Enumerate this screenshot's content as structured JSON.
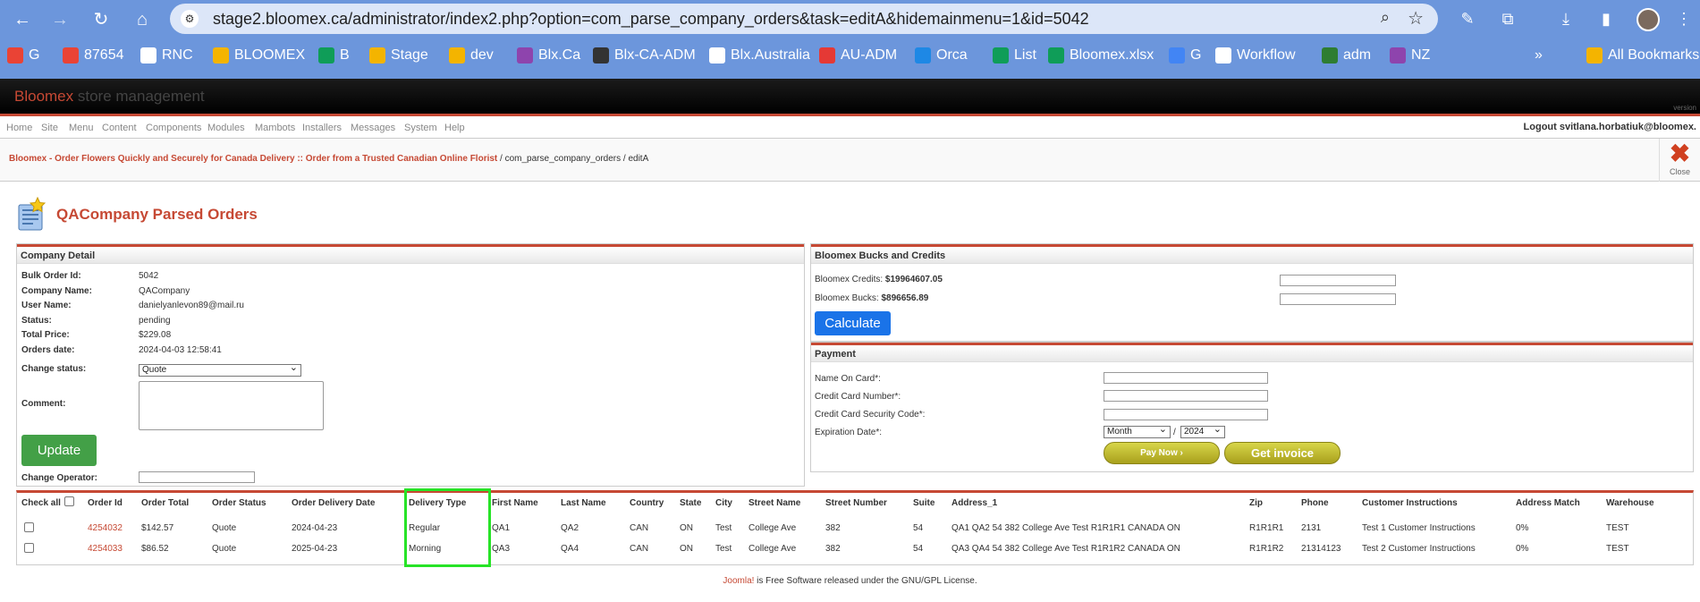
{
  "browser": {
    "url": "stage2.bloomex.ca/administrator/index2.php?option=com_parse_company_orders&task=editA&hidemainmenu=1&id=5042",
    "bookmarks": [
      {
        "label": "G",
        "color": "#ea4335"
      },
      {
        "label": "87654",
        "color": "#ea4335"
      },
      {
        "label": "RNC",
        "color": "#ffffff"
      },
      {
        "label": "BLOOMEX",
        "color": "#f4b400"
      },
      {
        "label": "B",
        "color": "#0f9d58"
      },
      {
        "label": "Stage",
        "color": "#f4b400"
      },
      {
        "label": "dev",
        "color": "#f4b400"
      },
      {
        "label": "Blx.Ca",
        "color": "#8e44ad"
      },
      {
        "label": "Blx-CA-ADM",
        "color": "#333333"
      },
      {
        "label": "Blx.Australia",
        "color": "#ffffff"
      },
      {
        "label": "AU-ADM",
        "color": "#e53935"
      },
      {
        "label": "Orca",
        "color": "#1e88e5"
      },
      {
        "label": "List",
        "color": "#0f9d58"
      },
      {
        "label": "Bloomex.xlsx",
        "color": "#0f9d58"
      },
      {
        "label": "G",
        "color": "#4285f4"
      },
      {
        "label": "Workflow",
        "color": "#ffffff"
      },
      {
        "label": "adm",
        "color": "#2e7d32"
      },
      {
        "label": "NZ",
        "color": "#8e44ad"
      }
    ],
    "all_bookmarks": "All Bookmarks"
  },
  "header": {
    "brand1": "Bloomex",
    "brand2": "store management",
    "version": "version"
  },
  "menu": {
    "items": [
      "Home",
      "Site",
      "Menu",
      "Content",
      "Components",
      "Modules",
      "Mambots",
      "Installers",
      "Messages",
      "System",
      "Help"
    ],
    "logout": "Logout svitlana.horbatiuk@bloomex."
  },
  "path": {
    "link": "Bloomex - Order Flowers Quickly and Securely for Canada Delivery :: Order from a Trusted Canadian Online Florist",
    "rest": " / com_parse_company_orders / editA",
    "close": "Close"
  },
  "page_title": "QACompany Parsed Orders",
  "company": {
    "header": "Company Detail",
    "fields": [
      {
        "k": "Bulk Order Id:",
        "v": "5042"
      },
      {
        "k": "Company Name:",
        "v": "QACompany"
      },
      {
        "k": "User Name:",
        "v": "danielyanlevon89@mail.ru"
      },
      {
        "k": "Status:",
        "v": "pending"
      },
      {
        "k": "Total Price:",
        "v": "$229.08"
      },
      {
        "k": "Orders date:",
        "v": "2024-04-03 12:58:41"
      }
    ],
    "change_status_label": "Change status:",
    "change_status_value": "Quote",
    "comment_label": "Comment:",
    "update_button": "Update",
    "change_operator_label": "Change Operator:"
  },
  "bucks": {
    "header": "Bloomex Bucks and Credits",
    "credits_label": "Bloomex Credits: ",
    "credits_value": "$19964607.05",
    "bucks_label": "Bloomex Bucks: ",
    "bucks_value": "$896656.89",
    "calculate_button": "Calculate"
  },
  "payment": {
    "header": "Payment",
    "name_label": "Name On Card*:",
    "cc_label": "Credit Card Number*:",
    "cvv_label": "Credit Card Security Code*:",
    "exp_label": "Expiration Date*:",
    "month_value": "Month",
    "year_value": "2024",
    "pay_button": "Pay Now ›",
    "invoice_button": "Get invoice"
  },
  "orders": {
    "check_all": "Check all",
    "columns": [
      "Order Id",
      "Order Total",
      "Order Status",
      "Order Delivery Date",
      "Delivery Type",
      "First Name",
      "Last Name",
      "Country",
      "State",
      "City",
      "Street Name",
      "Street Number",
      "Suite",
      "Address_1",
      "Zip",
      "Phone",
      "Customer Instructions",
      "Address Match",
      "Warehouse"
    ],
    "rows": [
      [
        "4254032",
        "$142.57",
        "Quote",
        "2024-04-23",
        "Regular",
        "QA1",
        "QA2",
        "CAN",
        "ON",
        "Test",
        "College Ave",
        "382",
        "54",
        "QA1 QA2 54 382 College Ave Test R1R1R1 CANADA ON",
        "R1R1R1",
        "2131",
        "Test 1 Customer Instructions",
        "0%",
        "TEST"
      ],
      [
        "4254033",
        "$86.52",
        "Quote",
        "2025-04-23",
        "Morning",
        "QA3",
        "QA4",
        "CAN",
        "ON",
        "Test",
        "College Ave",
        "382",
        "54",
        "QA3 QA4 54 382 College Ave Test R1R1R2 CANADA ON",
        "R1R1R2",
        "21314123",
        "Test 2 Customer Instructions",
        "0%",
        "TEST"
      ]
    ]
  },
  "footer": {
    "joomla": "Joomla!",
    "rest": " is Free Software released under the GNU/GPL License."
  }
}
